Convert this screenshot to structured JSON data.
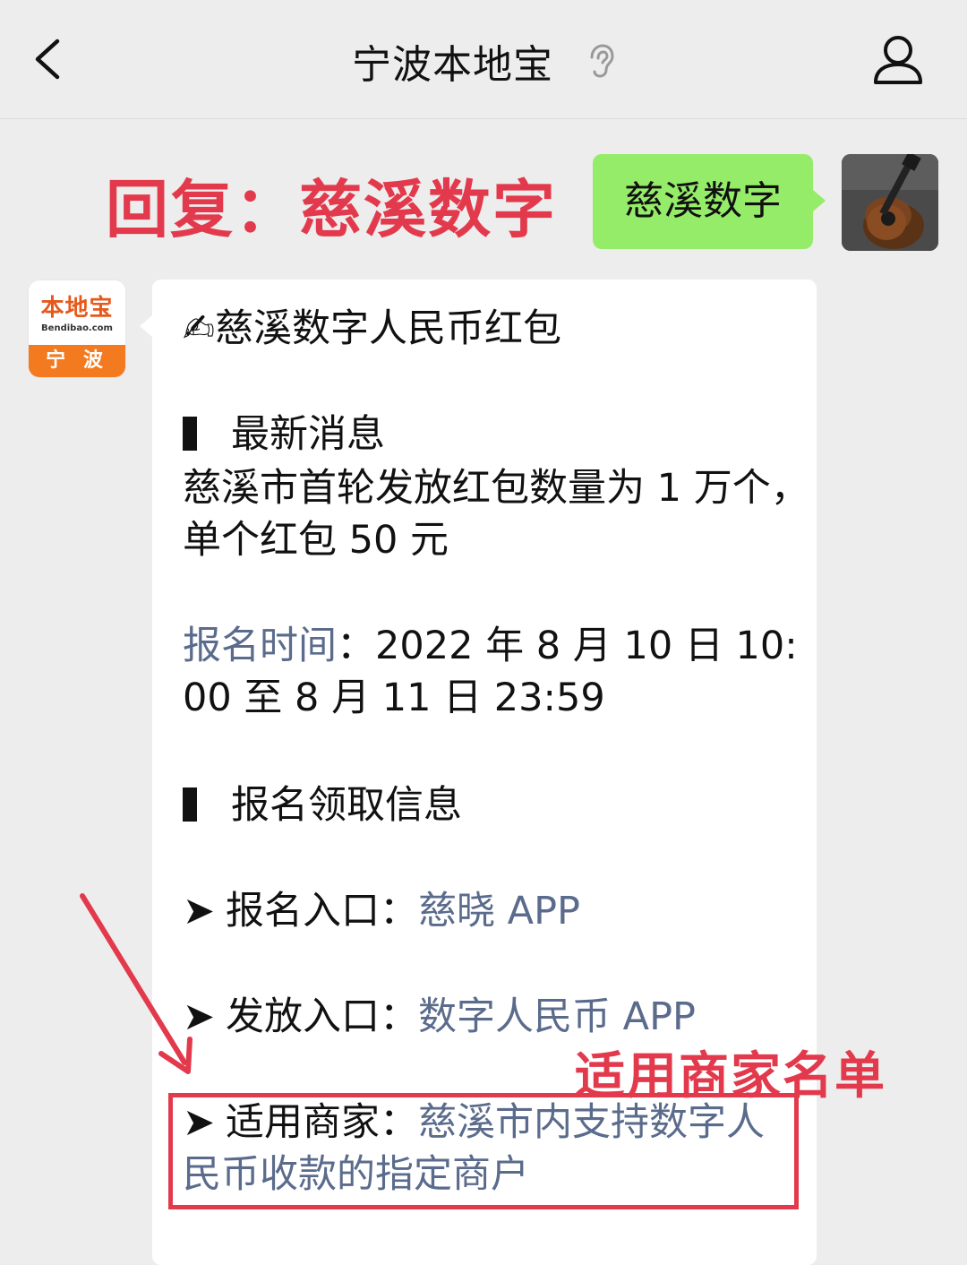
{
  "header": {
    "title": "宁波本地宝"
  },
  "annotation": {
    "reply_hint": "回复：慈溪数字",
    "merchant_label": "适用商家名单"
  },
  "user_message": {
    "text": "慈溪数字"
  },
  "bot_avatar": {
    "logo_text": "本地宝",
    "logo_sub": "Bendibao.com",
    "city": "宁 波"
  },
  "bot_message": {
    "title": "✍慈溪数字人民币红包",
    "section1_heading": "最新消息",
    "news_line1": "慈溪市首轮发放红包数量为 1 万个，",
    "news_line2": "单个红包 50 元",
    "signup_time_label": "报名时间",
    "signup_time_sep": "：",
    "signup_time_line1": "2022 年 8 月 10 日 10:",
    "signup_time_line2": "00 至 8 月 11 日 23:59",
    "section2_heading": "报名领取信息",
    "arrow": "➤",
    "entry_label": "报名入口：",
    "entry_value": "慈晓 APP",
    "issue_label": "发放入口：",
    "issue_value": "数字人民币 APP",
    "merchant_label": "适用商家：",
    "merchant_value_line1": "慈溪市内支持数字人",
    "merchant_value_line2": "民币收款的指定商户"
  },
  "colors": {
    "background": "#ededed",
    "user_bubble": "#95ec69",
    "bot_bubble": "#ffffff",
    "annotation_red": "#e23a4c",
    "link_blue": "#5a6b8c"
  }
}
